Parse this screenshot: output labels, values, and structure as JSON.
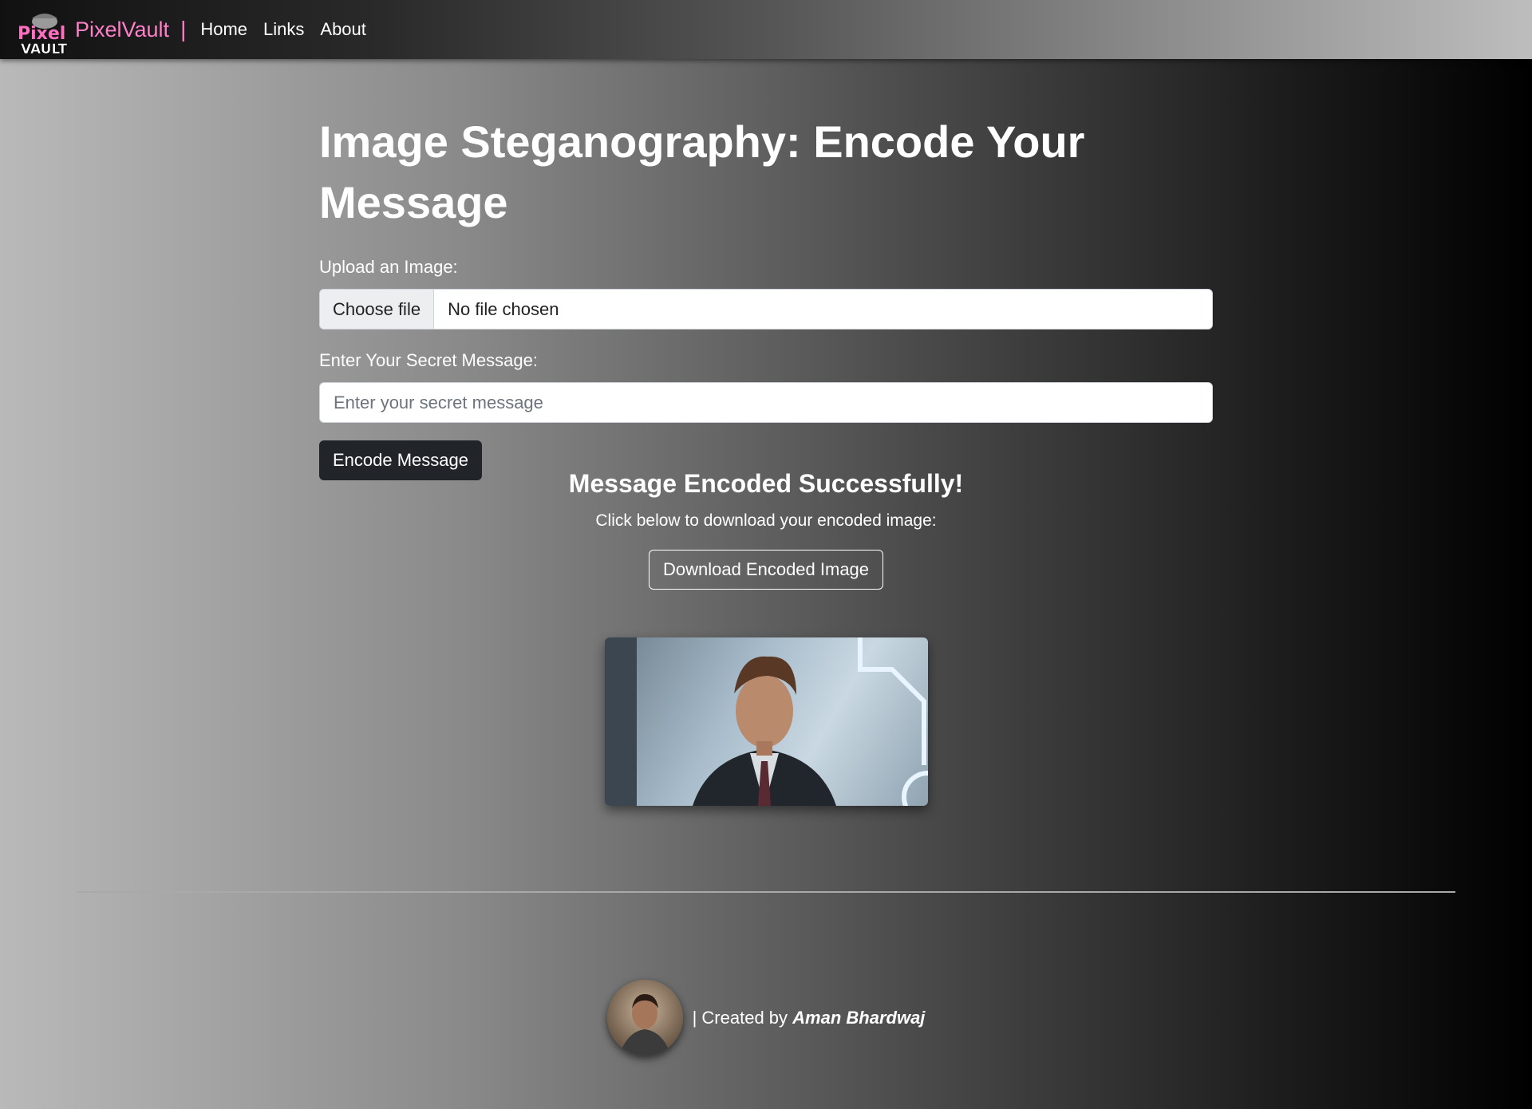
{
  "nav": {
    "logo_text_top": "Pixel",
    "logo_text_bottom": "VAULT",
    "brand": "PixelVault",
    "separator": "|",
    "links": [
      "Home",
      "Links",
      "About"
    ]
  },
  "form": {
    "title": "Image Steganography: Encode Your Message",
    "upload_label": "Upload an Image:",
    "file_button": "Choose file",
    "file_status": "No file chosen",
    "message_label": "Enter Your Secret Message:",
    "message_value": "",
    "message_placeholder": "Enter your secret message",
    "encode_button": "Encode Message"
  },
  "result": {
    "title": "Message Encoded Successfully!",
    "subtitle": "Click below to download your encoded image:",
    "download_button": "Download Encoded Image"
  },
  "footer": {
    "prefix": "| Created by",
    "author": "Aman Bhardwaj"
  },
  "colors": {
    "brand_pink": "#ff7fc8",
    "dark_button": "#212529"
  }
}
